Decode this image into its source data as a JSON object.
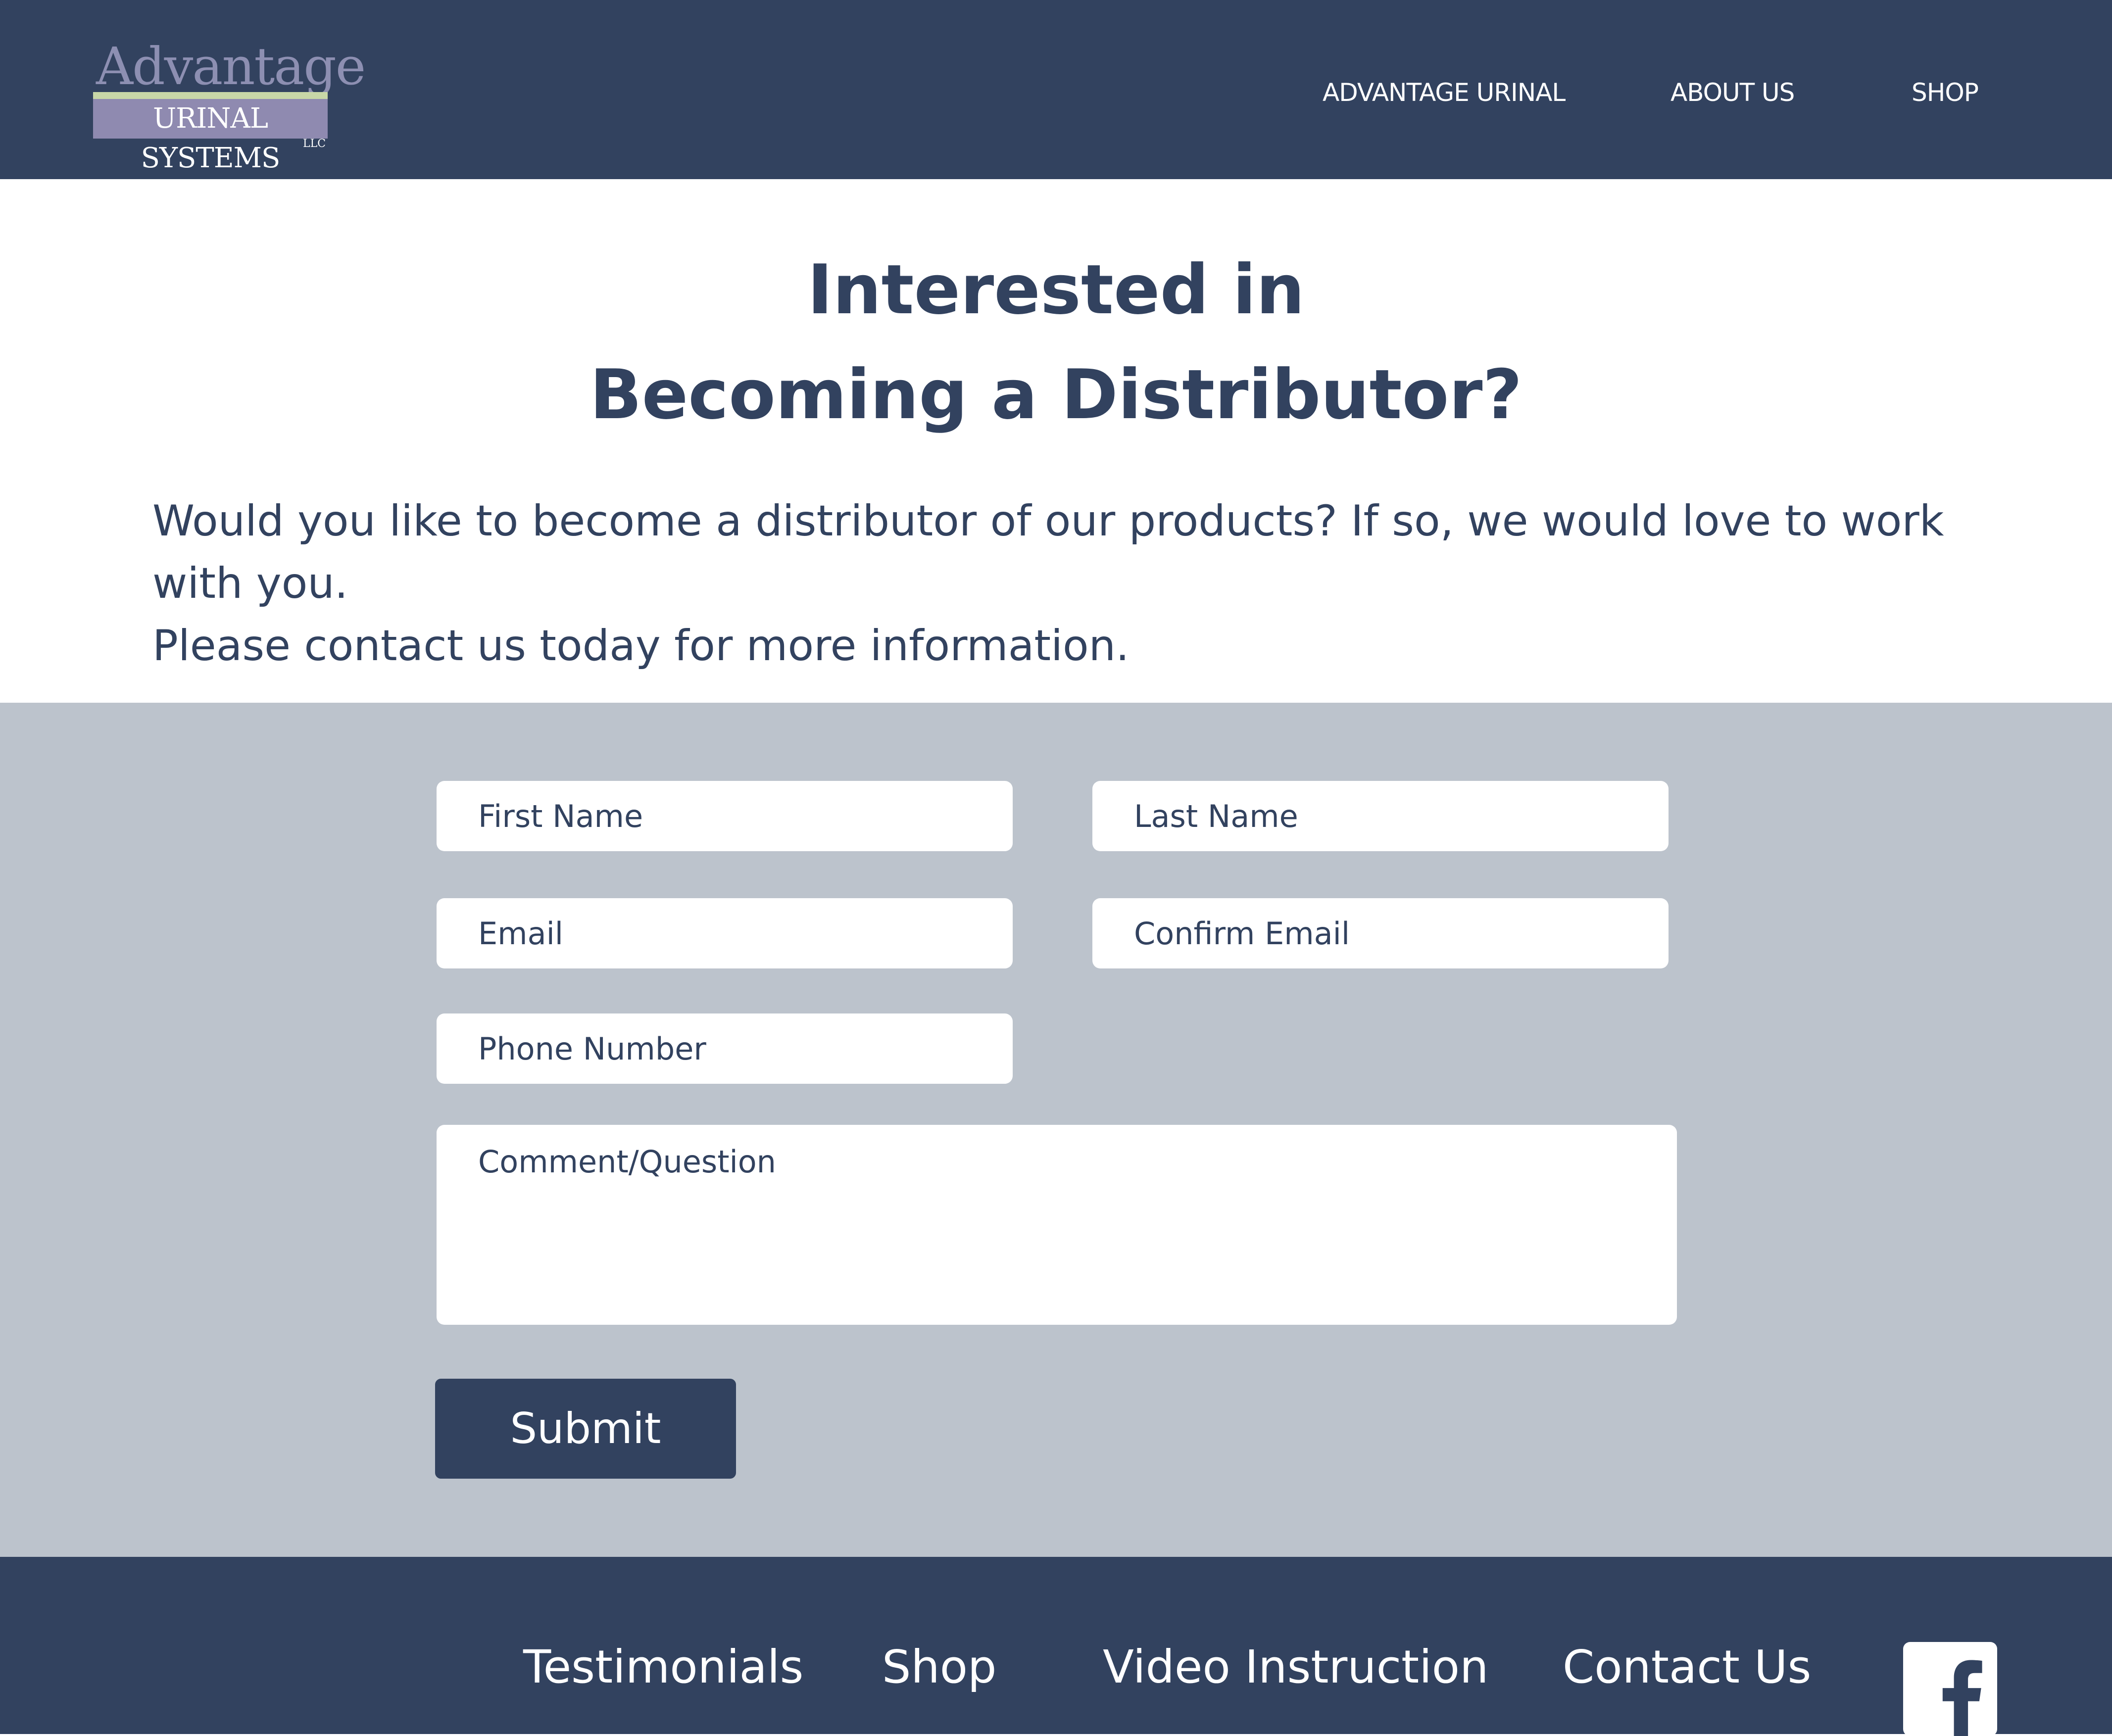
{
  "header": {
    "logo": {
      "title": "Advantage",
      "subtitle": "URINAL SYSTEMS",
      "suffix": "LLC"
    },
    "nav": [
      {
        "label": "ADVANTAGE URINAL"
      },
      {
        "label": "ABOUT US"
      },
      {
        "label": "SHOP"
      }
    ]
  },
  "main": {
    "heading_line1": "Interested in",
    "heading_line2": "Becoming a Distributor?",
    "intro_line1": "Would you like to become a distributor of our products? If so, we would love to work with you.",
    "intro_line2": "Please contact us today for more information."
  },
  "form": {
    "first_name_placeholder": "First Name",
    "last_name_placeholder": "Last Name",
    "email_placeholder": "Email",
    "confirm_email_placeholder": "Confirm Email",
    "phone_placeholder": "Phone Number",
    "comment_placeholder": "Comment/Question",
    "submit_label": "Submit"
  },
  "footer": {
    "links": [
      {
        "label": "Testimonials"
      },
      {
        "label": "Shop"
      },
      {
        "label": "Video Instruction"
      },
      {
        "label": "Contact Us"
      }
    ],
    "social_icon": "facebook-icon"
  },
  "colors": {
    "primary": "#32425f",
    "form_background": "#bcc3cc",
    "logo_accent": "#8f8ab0",
    "logo_stripe": "#c8d7a7"
  }
}
